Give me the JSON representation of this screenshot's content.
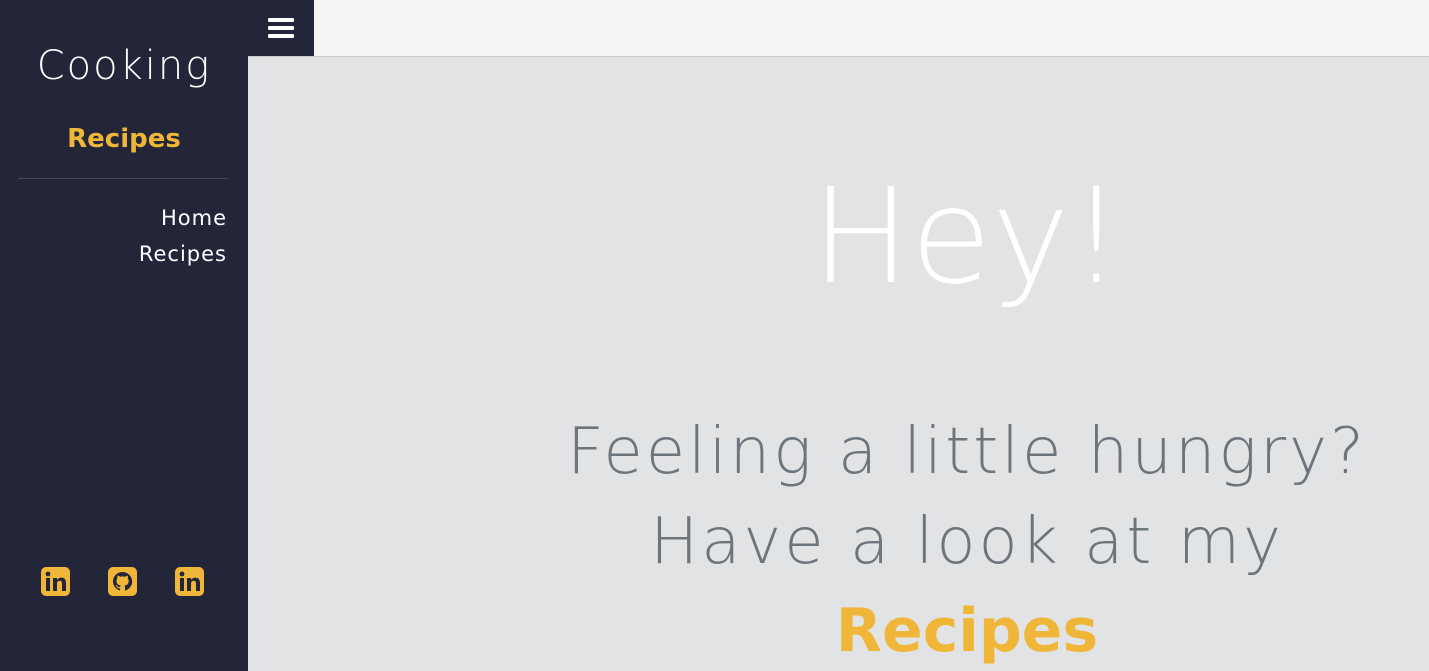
{
  "sidebar": {
    "brand_title": "Cooking",
    "brand_subtitle": "Recipes",
    "nav": [
      {
        "label": "Home"
      },
      {
        "label": "Recipes"
      }
    ],
    "social": [
      {
        "icon": "linkedin-icon"
      },
      {
        "icon": "github-icon"
      },
      {
        "icon": "linkedin-icon"
      }
    ]
  },
  "topbar": {
    "menu_icon": "hamburger-icon"
  },
  "hero": {
    "title": "Hey!",
    "line1": "Feeling a little hungry?",
    "line2": "Have a look at my",
    "link": "Recipes"
  },
  "colors": {
    "sidebar_bg": "#232638",
    "accent": "#f0b63a",
    "main_bg": "#e2e3e5",
    "topbar_bg": "#f4f4f4",
    "hero_text": "#6c747c"
  }
}
